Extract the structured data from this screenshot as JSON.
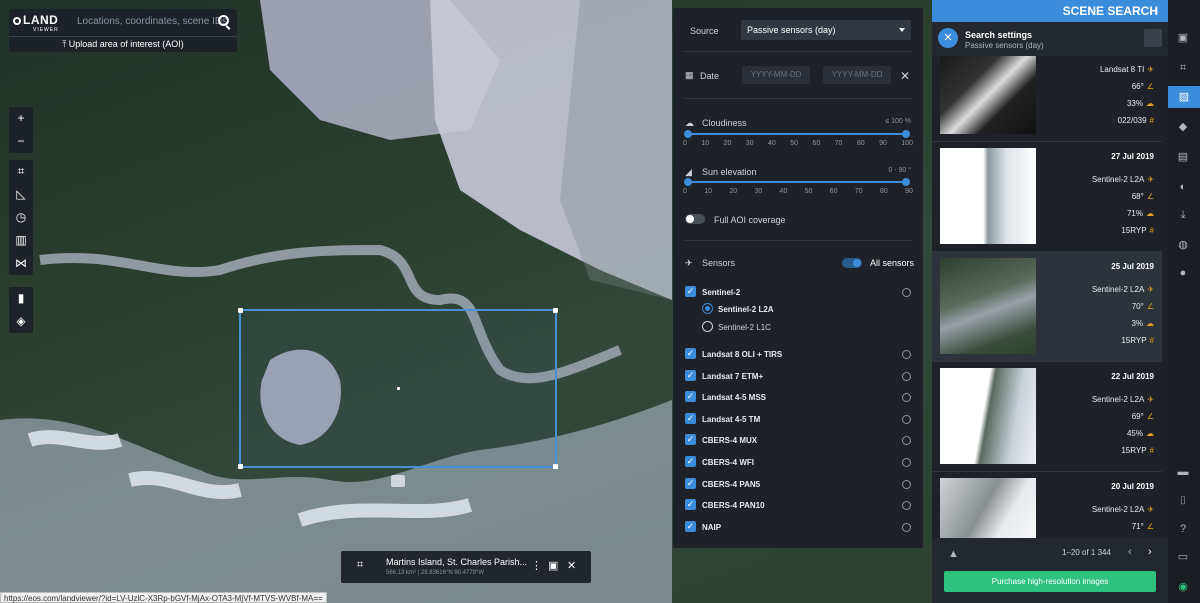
{
  "app": {
    "logo": "LAND",
    "logo_sub": "VIEWER"
  },
  "search": {
    "placeholder": "Locations, coordinates, scene IDs",
    "upload_label": "Upload area of interest (AOI)"
  },
  "map_tools": {
    "zoom_in": "+",
    "zoom_out": "−"
  },
  "aoi_card": {
    "title": "Martins Island, St. Charles Parish...",
    "subtitle": "566.13 km² | 29.83616°N 90.4779°W"
  },
  "status_url": "https://eos.com/landviewer/?id=LV-UzlC-X3Rp-bGVf-MjAx-OTA3-MjVf-MTVS-WVBf-MA==",
  "settings": {
    "source_label": "Source",
    "source_value": "Passive sensors (day)",
    "date_label": "Date",
    "date_from_placeholder": "YYYY-MM-DD",
    "date_to_placeholder": "YYYY-MM-DD",
    "cloudiness_label": "Cloudiness",
    "cloudiness_range": "≤ 100 %",
    "cloud_ticks": [
      "0",
      "10",
      "20",
      "30",
      "40",
      "50",
      "60",
      "70",
      "80",
      "90",
      "100"
    ],
    "sun_label": "Sun elevation",
    "sun_range": "0 - 90 °",
    "sun_ticks": [
      "0",
      "10",
      "20",
      "30",
      "40",
      "50",
      "60",
      "70",
      "80",
      "90"
    ],
    "full_aoi_label": "Full AOI coverage",
    "full_aoi_on": false,
    "sensors_label": "Sensors",
    "all_sensors_label": "All sensors",
    "all_sensors_on": true,
    "sentinel2": "Sentinel-2",
    "sentinel2_l2a": "Sentinel-2 L2A",
    "sentinel2_l1c": "Sentinel-2 L1C",
    "sensors": [
      "Landsat 8 OLI + TIRS",
      "Landsat 7 ETM+",
      "Landsat 4-5 MSS",
      "Landsat 4-5 TM",
      "CBERS-4 MUX",
      "CBERS-4 WFI",
      "CBERS-4 PAN5",
      "CBERS-4 PAN10",
      "NAIP"
    ]
  },
  "scene_search": {
    "header": "SCENE SEARCH",
    "settings_title": "Search settings",
    "settings_sub": "Passive sensors (day)",
    "scenes": [
      {
        "date": "",
        "sensor": "Landsat 8 TI",
        "sun": "66°",
        "cloud": "33%",
        "tile": "022/039"
      },
      {
        "date": "27 Jul 2019",
        "sensor": "Sentinel-2 L2A",
        "sun": "68°",
        "cloud": "71%",
        "tile": "15RYP"
      },
      {
        "date": "25 Jul 2019",
        "sensor": "Sentinel-2 L2A",
        "sun": "70°",
        "cloud": "3%",
        "tile": "15RYP"
      },
      {
        "date": "22 Jul 2019",
        "sensor": "Sentinel-2 L2A",
        "sun": "69°",
        "cloud": "45%",
        "tile": "15RYP"
      },
      {
        "date": "20 Jul 2019",
        "sensor": "Sentinel-2 L2A",
        "sun": "71°",
        "cloud": "",
        "tile": ""
      }
    ],
    "pager": "1–20 of 1 344",
    "buy_label": "Purchase high-resolution images"
  }
}
